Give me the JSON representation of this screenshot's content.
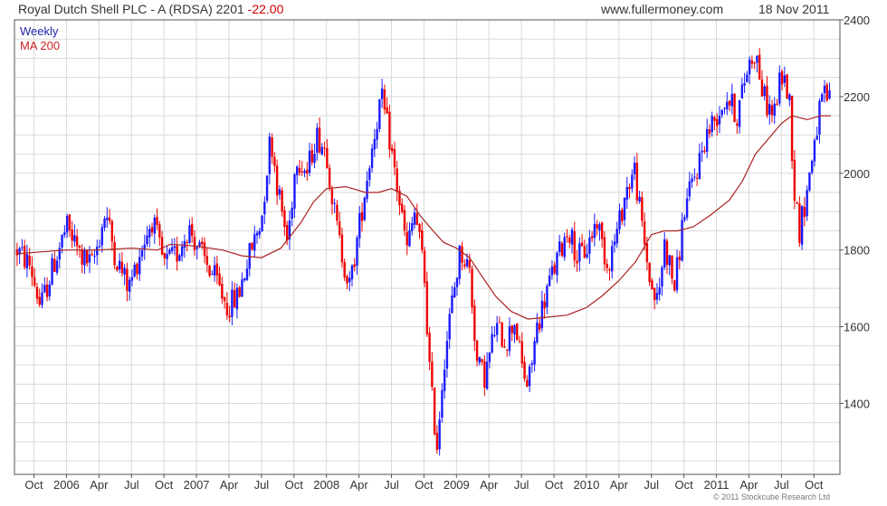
{
  "header": {
    "title": "Royal Dutch Shell PLC - A (RDSA) 2201",
    "change": "-22.00",
    "source": "www.fullermoney.com",
    "date": "18 Nov 2011"
  },
  "legend": {
    "weekly": "Weekly",
    "ma": "MA 200"
  },
  "copyright": "© 2011 Stockcube Research Ltd",
  "chart_data": {
    "type": "candlestick",
    "frequency": "weekly",
    "ylim": [
      1215,
      2400
    ],
    "yticks": [
      1400,
      1600,
      1800,
      2000,
      2200,
      2400
    ],
    "y_axis_side": "right",
    "grid": true,
    "xlim": [
      2005.6,
      2011.95
    ],
    "x_tick_labels": [
      {
        "label": "Oct",
        "t": 2005.75
      },
      {
        "label": "2006",
        "t": 2006.0
      },
      {
        "label": "Apr",
        "t": 2006.25
      },
      {
        "label": "Jul",
        "t": 2006.5
      },
      {
        "label": "Oct",
        "t": 2006.75
      },
      {
        "label": "2007",
        "t": 2007.0
      },
      {
        "label": "Apr",
        "t": 2007.25
      },
      {
        "label": "Jul",
        "t": 2007.5
      },
      {
        "label": "Oct",
        "t": 2007.75
      },
      {
        "label": "2008",
        "t": 2008.0
      },
      {
        "label": "Apr",
        "t": 2008.25
      },
      {
        "label": "Jul",
        "t": 2008.5
      },
      {
        "label": "Oct",
        "t": 2008.75
      },
      {
        "label": "2009",
        "t": 2009.0
      },
      {
        "label": "Apr",
        "t": 2009.25
      },
      {
        "label": "Jul",
        "t": 2009.5
      },
      {
        "label": "Oct",
        "t": 2009.75
      },
      {
        "label": "2010",
        "t": 2010.0
      },
      {
        "label": "Apr",
        "t": 2010.25
      },
      {
        "label": "Jul",
        "t": 2010.5
      },
      {
        "label": "Oct",
        "t": 2010.75
      },
      {
        "label": "2011",
        "t": 2011.0
      },
      {
        "label": "Apr",
        "t": 2011.25
      },
      {
        "label": "Jul",
        "t": 2011.5
      },
      {
        "label": "Oct",
        "t": 2011.75
      }
    ],
    "price_path": [
      [
        2005.62,
        1800
      ],
      [
        2005.72,
        1760
      ],
      [
        2005.8,
        1650
      ],
      [
        2005.9,
        1760
      ],
      [
        2006.0,
        1860
      ],
      [
        2006.12,
        1780
      ],
      [
        2006.2,
        1760
      ],
      [
        2006.3,
        1900
      ],
      [
        2006.38,
        1780
      ],
      [
        2006.48,
        1700
      ],
      [
        2006.57,
        1800
      ],
      [
        2006.66,
        1880
      ],
      [
        2006.75,
        1760
      ],
      [
        2006.85,
        1790
      ],
      [
        2006.94,
        1860
      ],
      [
        2007.05,
        1780
      ],
      [
        2007.15,
        1720
      ],
      [
        2007.24,
        1650
      ],
      [
        2007.32,
        1680
      ],
      [
        2007.4,
        1780
      ],
      [
        2007.5,
        1880
      ],
      [
        2007.57,
        2100
      ],
      [
        2007.63,
        1950
      ],
      [
        2007.7,
        1820
      ],
      [
        2007.77,
        2050
      ],
      [
        2007.85,
        2000
      ],
      [
        2007.92,
        2100
      ],
      [
        2008.0,
        2060
      ],
      [
        2008.06,
        1900
      ],
      [
        2008.1,
        1820
      ],
      [
        2008.18,
        1700
      ],
      [
        2008.26,
        1880
      ],
      [
        2008.34,
        2050
      ],
      [
        2008.42,
        2200
      ],
      [
        2008.48,
        2100
      ],
      [
        2008.55,
        1950
      ],
      [
        2008.62,
        1800
      ],
      [
        2008.68,
        1900
      ],
      [
        2008.75,
        1750
      ],
      [
        2008.8,
        1450
      ],
      [
        2008.85,
        1290
      ],
      [
        2008.9,
        1500
      ],
      [
        2008.96,
        1650
      ],
      [
        2009.03,
        1800
      ],
      [
        2009.1,
        1750
      ],
      [
        2009.16,
        1500
      ],
      [
        2009.22,
        1470
      ],
      [
        2009.3,
        1600
      ],
      [
        2009.38,
        1560
      ],
      [
        2009.45,
        1620
      ],
      [
        2009.5,
        1500
      ],
      [
        2009.55,
        1440
      ],
      [
        2009.62,
        1600
      ],
      [
        2009.7,
        1700
      ],
      [
        2009.78,
        1780
      ],
      [
        2009.86,
        1860
      ],
      [
        2009.93,
        1780
      ],
      [
        2010.0,
        1800
      ],
      [
        2010.08,
        1880
      ],
      [
        2010.16,
        1760
      ],
      [
        2010.24,
        1850
      ],
      [
        2010.3,
        1950
      ],
      [
        2010.37,
        2010
      ],
      [
        2010.43,
        1850
      ],
      [
        2010.5,
        1700
      ],
      [
        2010.55,
        1660
      ],
      [
        2010.6,
        1820
      ],
      [
        2010.68,
        1700
      ],
      [
        2010.75,
        1900
      ],
      [
        2010.84,
        2000
      ],
      [
        2010.92,
        2100
      ],
      [
        2011.0,
        2150
      ],
      [
        2011.08,
        2200
      ],
      [
        2011.16,
        2150
      ],
      [
        2011.24,
        2280
      ],
      [
        2011.3,
        2320
      ],
      [
        2011.36,
        2200
      ],
      [
        2011.44,
        2150
      ],
      [
        2011.5,
        2260
      ],
      [
        2011.56,
        2200
      ],
      [
        2011.6,
        1950
      ],
      [
        2011.64,
        1850
      ],
      [
        2011.7,
        1960
      ],
      [
        2011.76,
        2100
      ],
      [
        2011.82,
        2200
      ],
      [
        2011.88,
        2190
      ]
    ],
    "ma_path": [
      [
        2005.62,
        1790
      ],
      [
        2005.8,
        1795
      ],
      [
        2006.0,
        1800
      ],
      [
        2006.25,
        1800
      ],
      [
        2006.5,
        1805
      ],
      [
        2006.7,
        1800
      ],
      [
        2006.8,
        1815
      ],
      [
        2007.0,
        1810
      ],
      [
        2007.2,
        1800
      ],
      [
        2007.35,
        1785
      ],
      [
        2007.5,
        1780
      ],
      [
        2007.65,
        1805
      ],
      [
        2007.8,
        1870
      ],
      [
        2007.9,
        1925
      ],
      [
        2008.0,
        1960
      ],
      [
        2008.15,
        1965
      ],
      [
        2008.3,
        1950
      ],
      [
        2008.4,
        1950
      ],
      [
        2008.5,
        1960
      ],
      [
        2008.62,
        1940
      ],
      [
        2008.72,
        1890
      ],
      [
        2008.82,
        1850
      ],
      [
        2008.9,
        1820
      ],
      [
        2009.0,
        1805
      ],
      [
        2009.1,
        1780
      ],
      [
        2009.2,
        1730
      ],
      [
        2009.3,
        1680
      ],
      [
        2009.42,
        1640
      ],
      [
        2009.55,
        1620
      ],
      [
        2009.7,
        1625
      ],
      [
        2009.85,
        1630
      ],
      [
        2010.0,
        1650
      ],
      [
        2010.12,
        1680
      ],
      [
        2010.25,
        1720
      ],
      [
        2010.38,
        1770
      ],
      [
        2010.5,
        1840
      ],
      [
        2010.6,
        1850
      ],
      [
        2010.7,
        1850
      ],
      [
        2010.82,
        1860
      ],
      [
        2010.95,
        1890
      ],
      [
        2011.1,
        1930
      ],
      [
        2011.2,
        1980
      ],
      [
        2011.3,
        2050
      ],
      [
        2011.4,
        2090
      ],
      [
        2011.5,
        2130
      ],
      [
        2011.58,
        2150
      ],
      [
        2011.7,
        2140
      ],
      [
        2011.8,
        2150
      ],
      [
        2011.88,
        2150
      ]
    ],
    "colors": {
      "up": "#1a1aff",
      "down": "#ee0000",
      "ma": "#aa2222",
      "grid": "#d9d9d9",
      "frame": "#555555",
      "background": "#ffffff",
      "weekly_label": "#2222aa",
      "ma_label": "#cc2222"
    }
  }
}
